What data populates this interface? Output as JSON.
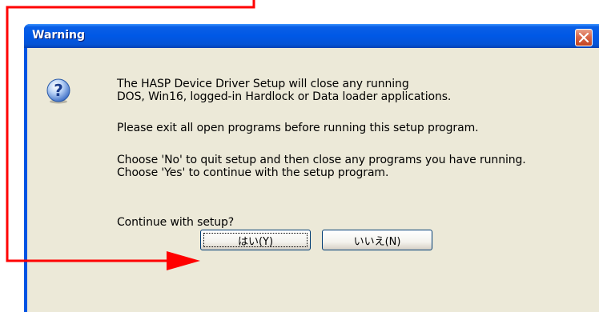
{
  "window": {
    "title": "Warning"
  },
  "dialog": {
    "icon": "question-icon",
    "lines": [
      "The HASP Device Driver Setup will close any running",
      "DOS, Win16, logged-in Hardlock or Data loader applications.",
      "Please exit all open programs before running this setup program.",
      "Choose 'No' to quit setup and then close any programs you have running.",
      "Choose 'Yes' to continue with the setup program.",
      "Continue with setup?"
    ]
  },
  "buttons": {
    "yes_label": "はい(Y)",
    "no_label": "いいえ(N)"
  },
  "annotation": {
    "color": "#ff0000",
    "target": "yes-button"
  }
}
